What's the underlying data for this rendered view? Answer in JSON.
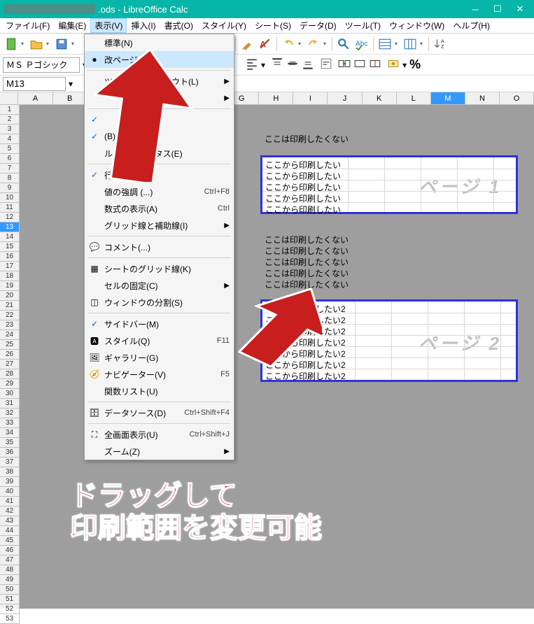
{
  "title": ".ods - LibreOffice Calc",
  "menubar": [
    "ファイル(F)",
    "編集(E)",
    "表示(V)",
    "挿入(I)",
    "書式(O)",
    "スタイル(Y)",
    "シート(S)",
    "データ(D)",
    "ツール(T)",
    "ウィンドウ(W)",
    "ヘルプ(H)"
  ],
  "menubar_active_index": 2,
  "fontbar": {
    "font_name": "ＭＳ Ｐゴシック"
  },
  "namebox": "M13",
  "view_menu": {
    "items": [
      {
        "label": "標準(N)",
        "icon": "",
        "hl": false
      },
      {
        "label": "改ページ(P)",
        "icon": "dot",
        "hl": true
      },
      {
        "sep": true
      },
      {
        "label": "ツールバーレイアウト(L)",
        "sub": true,
        "hidden_partial": true
      },
      {
        "label": "",
        "sub": true,
        "hidden_partial": true
      },
      {
        "sep": true
      },
      {
        "label": "",
        "check": true,
        "hidden_partial": true
      },
      {
        "label": "(B)",
        "check": true,
        "hidden_partial": true
      },
      {
        "label": "ステータス(E)",
        "hidden_prefix": "ルカ"
      },
      {
        "sep": true
      },
      {
        "label": "行と列 (...)",
        "check": true,
        "hidden_partial": true
      },
      {
        "label": "値の強調 (...)",
        "shortcut": "Ctrl+F8"
      },
      {
        "label": "数式の表示(A)",
        "shortcut": "Ctrl"
      },
      {
        "label": "グリッド線と補助線(I)",
        "sub": true
      },
      {
        "sep": true
      },
      {
        "label": "コメント(...)",
        "icon": "comment"
      },
      {
        "sep": true
      },
      {
        "label": "シートのグリッド線(K)",
        "icon": "grid"
      },
      {
        "label": "セルの固定(C)",
        "sub": true
      },
      {
        "label": "ウィンドウの分割(S)",
        "icon": "split"
      },
      {
        "sep": true
      },
      {
        "label": "サイドバー(M)",
        "check": true
      },
      {
        "label": "スタイル(Q)",
        "icon": "style",
        "shortcut": "F11"
      },
      {
        "label": "ギャラリー(G)",
        "icon": "gallery"
      },
      {
        "label": "ナビゲーター(V)",
        "icon": "nav",
        "shortcut": "F5"
      },
      {
        "label": "関数リスト(U)"
      },
      {
        "sep": true
      },
      {
        "label": "データソース(D)",
        "icon": "db",
        "shortcut": "Ctrl+Shift+F4"
      },
      {
        "sep": true
      },
      {
        "label": "全画面表示(U)",
        "icon": "full",
        "shortcut": "Ctrl+Shift+J"
      },
      {
        "label": "ズーム(Z)",
        "sub": true
      }
    ]
  },
  "columns": [
    "A",
    "B",
    "C",
    "D",
    "E",
    "F",
    "G",
    "H",
    "I",
    "J",
    "K",
    "L",
    "M",
    "N",
    "O"
  ],
  "sel_col": "M",
  "sel_row": 13,
  "cells": {
    "no_print_1": "ここは印刷したくない",
    "print1_lines": [
      "ここから印刷したい",
      "ここから印刷したい",
      "ここから印刷したい",
      "ここから印刷したい",
      "ここから印刷したい"
    ],
    "page1_wm": "ページ 1",
    "no_print_2_lines": [
      "ここは印刷したくない",
      "ここは印刷したくない",
      "ここは印刷したくない",
      "ここは印刷したくない",
      "ここは印刷したくない"
    ],
    "print2_lines": [
      "ここから印刷したい2",
      "ここから印刷したい2",
      "ここから印刷したい2",
      "ここから印刷したい2",
      "ここから印刷したい2",
      "ここから印刷したい2",
      "ここから印刷したい2"
    ],
    "page2_wm": "ページ 2"
  },
  "annotation": {
    "line1": "ドラッグして",
    "line2": "印刷範囲を変更可能"
  }
}
